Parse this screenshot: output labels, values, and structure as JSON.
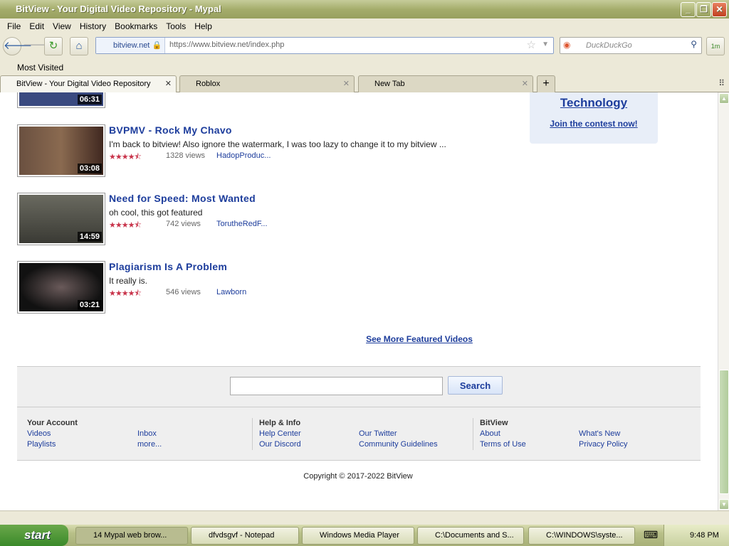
{
  "window": {
    "title": "BitView - Your Digital Video Repository - Mypal"
  },
  "menu": [
    "File",
    "Edit",
    "View",
    "History",
    "Bookmarks",
    "Tools",
    "Help"
  ],
  "nav": {
    "site_identity": "bitview.net",
    "url": "https://www.bitview.net/index.php",
    "search_placeholder": "DuckDuckGo",
    "addon_label": "1m"
  },
  "bookmarks": {
    "most_visited": "Most Visited"
  },
  "tabs": [
    {
      "label": "BitView - Your Digital Video Repository"
    },
    {
      "label": "Roblox"
    },
    {
      "label": "New Tab"
    }
  ],
  "videos": [
    {
      "duration": "06:31"
    },
    {
      "title": "BVPMV - Rock My Chavo",
      "description": "I'm back to bitview! Also ignore the watermark, I was too lazy to change it to my bitview ...",
      "rating": 4.5,
      "stars": "★★★★⯪",
      "views": "1328 views",
      "author": "HadopProduc...",
      "duration": "03:08",
      "color": "#6a5040"
    },
    {
      "title": "Need for Speed: Most Wanted",
      "description": "oh cool, this got featured",
      "rating": 4.5,
      "stars": "★★★★⯪",
      "views": "742 views",
      "author": "TorutheRedF...",
      "duration": "14:59",
      "color": "#4a4a44"
    },
    {
      "title": "Plagiarism Is A Problem",
      "description": "It really is.",
      "rating": 4.5,
      "stars": "★★★★⯪",
      "views": "546 views",
      "author": "Lawborn",
      "duration": "03:21",
      "color": "#1a1a18"
    }
  ],
  "contest": {
    "category": "Technology",
    "link": "Join the contest now!"
  },
  "see_more": "See More Featured Videos",
  "footer": {
    "search_button": "Search",
    "columns": [
      {
        "heading": "Your Account",
        "links": [
          "Videos",
          "Inbox",
          "Playlists",
          "more..."
        ]
      },
      {
        "heading": "Help & Info",
        "links": [
          "Help Center",
          "Our Twitter",
          "Our Discord",
          "Community Guidelines"
        ]
      },
      {
        "heading": "BitView",
        "links": [
          "About",
          "What's New",
          "Terms of Use",
          "Privacy Policy"
        ]
      }
    ],
    "copyright": "Copyright © 2017-2022 BitView"
  },
  "taskbar": {
    "start": "start",
    "tasks": [
      "14 Mypal web brow...",
      "dfvdsgvf - Notepad",
      "Windows Media Player",
      "C:\\Documents and S...",
      "C:\\WINDOWS\\syste..."
    ],
    "clock": "9:48 PM"
  },
  "colors": {
    "link": "#1d3d9c",
    "star": "#c8334a"
  }
}
